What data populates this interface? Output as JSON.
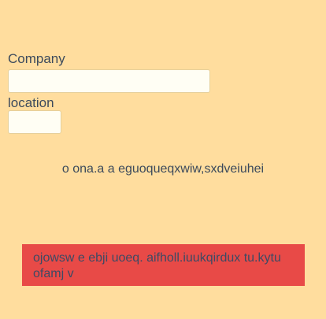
{
  "form": {
    "company_label": "Company",
    "company_value": "",
    "location_label": "location",
    "location_value": ""
  },
  "message": {
    "text": "o ona.a a eguoqueqxwiw,sxdveiuhei"
  },
  "alert": {
    "text": "ojowsw e ebji uoeq. aifholl.iuukqirdux tu.kytu ofamj v",
    "color": "#e84a47"
  },
  "colors": {
    "background": "#ffdd9e",
    "text": "#3c4a5c",
    "input_background": "#fffef4"
  }
}
